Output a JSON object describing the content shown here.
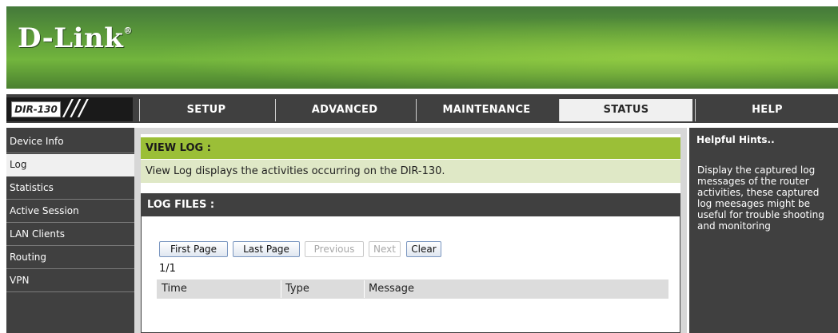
{
  "brand": {
    "logo": "D-Link",
    "registered_mark": "®",
    "model": "DIR-130",
    "model_slashes": "///"
  },
  "nav": {
    "tabs": [
      {
        "label": "SETUP"
      },
      {
        "label": "ADVANCED"
      },
      {
        "label": "MAINTENANCE"
      },
      {
        "label": "STATUS",
        "active": true
      },
      {
        "label": "HELP"
      }
    ]
  },
  "sidebar": {
    "items": [
      {
        "label": "Device Info"
      },
      {
        "label": "Log",
        "active": true
      },
      {
        "label": "Statistics"
      },
      {
        "label": "Active Session"
      },
      {
        "label": "LAN Clients"
      },
      {
        "label": "Routing"
      },
      {
        "label": "VPN"
      }
    ]
  },
  "view_log": {
    "title": "VIEW LOG :",
    "description": "View Log displays the activities occurring on the DIR-130."
  },
  "log_files": {
    "title": "LOG FILES :",
    "buttons": {
      "first_page": "First Page",
      "last_page": "Last Page",
      "previous": "Previous",
      "next": "Next",
      "clear": "Clear"
    },
    "page_info": "1/1",
    "table_headers": [
      "Time",
      "Type",
      "Message"
    ]
  },
  "help": {
    "title": "Helpful Hints..",
    "text": "Display the captured log messages of the router activities, these captured log meesages might be useful for trouble shooting and monitoring"
  },
  "colors": {
    "banner_green": "#5b9a39",
    "nav_dark": "#404040",
    "section_green": "#9bbf37",
    "desc_bg": "#dfe8c6"
  }
}
